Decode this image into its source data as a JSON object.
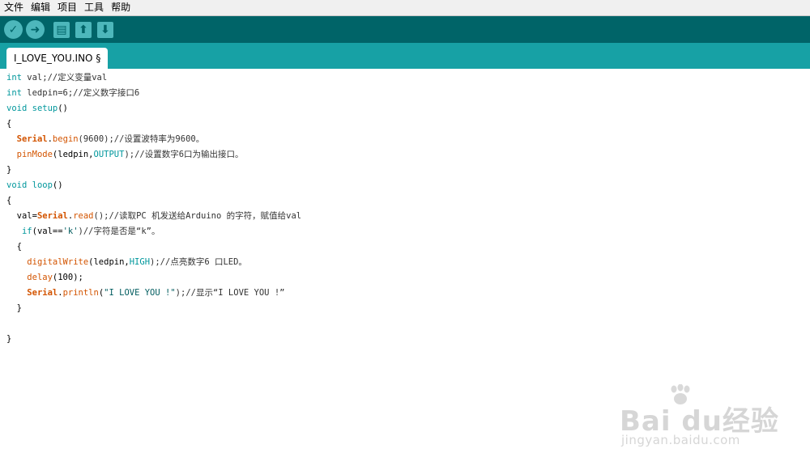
{
  "menubar": {
    "items": [
      "文件",
      "编辑",
      "项目",
      "工具",
      "帮助"
    ]
  },
  "toolbar": {
    "buttons": [
      {
        "name": "verify",
        "icon": "check-icon",
        "glyph": "✓"
      },
      {
        "name": "upload",
        "icon": "arrow-right-icon",
        "glyph": "➜"
      },
      {
        "name": "new",
        "icon": "new-file-icon",
        "glyph": "▤"
      },
      {
        "name": "open",
        "icon": "arrow-up-icon",
        "glyph": "⬆"
      },
      {
        "name": "save",
        "icon": "arrow-down-icon",
        "glyph": "⬇"
      }
    ]
  },
  "tabs": [
    {
      "label": "I_LOVE_YOU.INO §"
    }
  ],
  "code": {
    "lines": [
      [
        {
          "t": "int",
          "c": "kw"
        },
        {
          "t": " val;//定义变量val",
          "c": "cm"
        }
      ],
      [
        {
          "t": "int",
          "c": "kw"
        },
        {
          "t": " ledpin=6;//定义数字接口6",
          "c": "cm"
        }
      ],
      [
        {
          "t": "void",
          "c": "kw"
        },
        {
          "t": " ",
          "c": ""
        },
        {
          "t": "setup",
          "c": "kw"
        },
        {
          "t": "()",
          "c": ""
        }
      ],
      [
        {
          "t": "{",
          "c": ""
        }
      ],
      [
        {
          "t": "  ",
          "c": ""
        },
        {
          "t": "Serial",
          "c": "fn-bold"
        },
        {
          "t": ".",
          "c": ""
        },
        {
          "t": "begin",
          "c": "fn"
        },
        {
          "t": "(9600);//设置波特率为9600。",
          "c": "cm"
        }
      ],
      [
        {
          "t": "  ",
          "c": ""
        },
        {
          "t": "pinMode",
          "c": "fn"
        },
        {
          "t": "(ledpin,",
          "c": ""
        },
        {
          "t": "OUTPUT",
          "c": "cst"
        },
        {
          "t": ");//设置数字6口为输出接口。",
          "c": "cm"
        }
      ],
      [
        {
          "t": "}",
          "c": ""
        }
      ],
      [
        {
          "t": "void",
          "c": "kw"
        },
        {
          "t": " ",
          "c": ""
        },
        {
          "t": "loop",
          "c": "kw"
        },
        {
          "t": "()",
          "c": ""
        }
      ],
      [
        {
          "t": "{",
          "c": ""
        }
      ],
      [
        {
          "t": "  val=",
          "c": ""
        },
        {
          "t": "Serial",
          "c": "fn-bold"
        },
        {
          "t": ".",
          "c": ""
        },
        {
          "t": "read",
          "c": "fn"
        },
        {
          "t": "();//读取PC 机发送给Arduino 的字符，赋值给val",
          "c": "cm"
        }
      ],
      [
        {
          "t": "   ",
          "c": ""
        },
        {
          "t": "if",
          "c": "kw"
        },
        {
          "t": "(val==",
          "c": ""
        },
        {
          "t": "'k'",
          "c": "str"
        },
        {
          "t": ")//字符是否是“k”。",
          "c": "cm"
        }
      ],
      [
        {
          "t": "  {",
          "c": ""
        }
      ],
      [
        {
          "t": "    ",
          "c": ""
        },
        {
          "t": "digitalWrite",
          "c": "fn"
        },
        {
          "t": "(ledpin,",
          "c": ""
        },
        {
          "t": "HIGH",
          "c": "cst"
        },
        {
          "t": ");//点亮数字6 口LED。",
          "c": "cm"
        }
      ],
      [
        {
          "t": "    ",
          "c": ""
        },
        {
          "t": "delay",
          "c": "fn"
        },
        {
          "t": "(100);",
          "c": ""
        }
      ],
      [
        {
          "t": "    ",
          "c": ""
        },
        {
          "t": "Serial",
          "c": "fn-bold"
        },
        {
          "t": ".",
          "c": ""
        },
        {
          "t": "println",
          "c": "fn"
        },
        {
          "t": "(",
          "c": ""
        },
        {
          "t": "\"I LOVE YOU !\"",
          "c": "str"
        },
        {
          "t": ");//显示“I LOVE YOU !”",
          "c": "cm"
        }
      ],
      [
        {
          "t": "  }",
          "c": ""
        }
      ],
      [
        {
          "t": "",
          "c": ""
        }
      ],
      [
        {
          "t": "}",
          "c": ""
        }
      ]
    ]
  },
  "watermark": {
    "brand": "Bai du经验",
    "url": "jingyan.baidu.com"
  },
  "colors": {
    "toolbar": "#006468",
    "tabbar": "#17a1a5",
    "button": "#4db7bb",
    "keyword": "#00979c",
    "function": "#d35400"
  }
}
